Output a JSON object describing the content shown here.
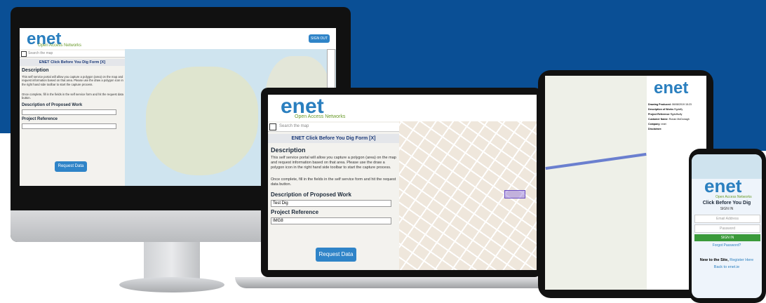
{
  "brand": {
    "logo": "enet",
    "tagline": "Open Access Networks"
  },
  "header": {
    "sign_out": "SIGN OUT"
  },
  "search": {
    "placeholder": "Search the map"
  },
  "form": {
    "title": "ENET Click Before You Dig Form [X]",
    "description_heading": "Description",
    "description_text": "This self service portal will allow you capture a polygon (area) on the map and request information based on that area. Please use the draw a polygon icon in the right hand side toolbar to start the capture process.",
    "instructions_text": "Once complete, fill in the fields in the self service form and hit the request data button.",
    "work_label": "Description of Proposed Work",
    "work_value": "Test Dig",
    "ref_label": "Project Reference",
    "ref_value": "IMG8",
    "submit": "Request Data"
  },
  "tablet": {
    "fields": [
      {
        "label": "Drawing Produced:",
        "value": "06/08/2019 15:23"
      },
      {
        "label": "Description of Works",
        "value": "Rgdsffy"
      },
      {
        "label": "Project Reference",
        "value": "Rgdsffsdfy"
      },
      {
        "label": "Customer Name:",
        "value": "Ronan McDonagh"
      },
      {
        "label": "Company:",
        "value": "enet"
      },
      {
        "label": "Disclaimer:",
        "value": ""
      }
    ]
  },
  "phone": {
    "title": "Click Before You Dig",
    "subtitle": "SIGN IN",
    "email_placeholder": "Email Address",
    "password_placeholder": "Password",
    "sign_in": "SIGN IN",
    "forgot": "Forgot Password?",
    "new_text": "New to the Site,",
    "register": "Register Here",
    "back": "Back to enet.ie"
  },
  "colors": {
    "band": "#0a4f95",
    "button": "#2f84c8",
    "signin": "#3a9a3a"
  }
}
